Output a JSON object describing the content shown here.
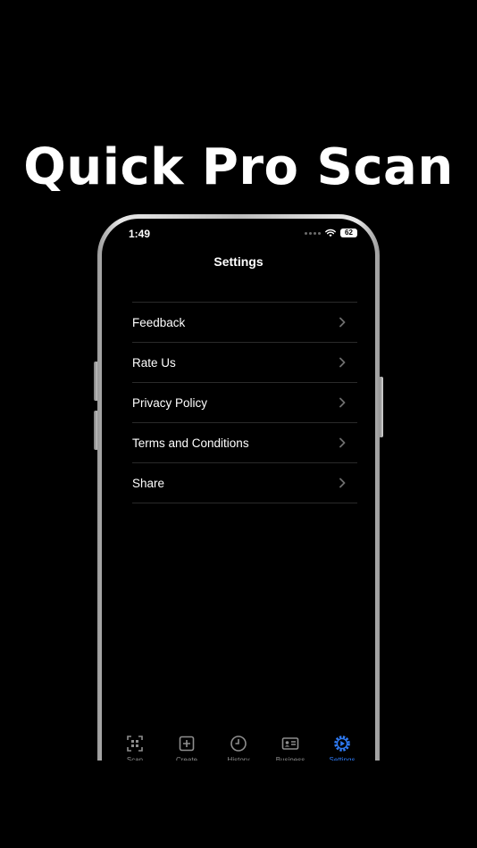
{
  "headline": "Quick Pro Scan",
  "status_bar": {
    "time": "1:49",
    "battery": "62"
  },
  "screen": {
    "title": "Settings",
    "items": [
      {
        "label": "Feedback"
      },
      {
        "label": "Rate Us"
      },
      {
        "label": "Privacy Policy"
      },
      {
        "label": "Terms and Conditions"
      },
      {
        "label": "Share"
      }
    ]
  },
  "tab_bar": {
    "tabs": [
      {
        "label": "Scan",
        "icon": "qr-scan-icon",
        "active": false
      },
      {
        "label": "Create",
        "icon": "plus-square-icon",
        "active": false
      },
      {
        "label": "History",
        "icon": "clock-icon",
        "active": false
      },
      {
        "label": "Business",
        "icon": "id-card-icon",
        "active": false
      },
      {
        "label": "Settings",
        "icon": "gear-icon",
        "active": true
      }
    ]
  },
  "colors": {
    "background": "#000000",
    "accent": "#2f7bf5",
    "inactive": "#8e8e8e",
    "divider": "#2a2a2a"
  }
}
